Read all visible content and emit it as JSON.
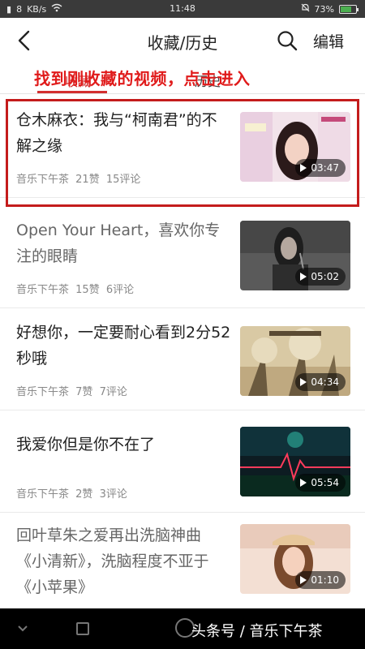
{
  "status_bar": {
    "signal": "8",
    "speed": "KB/s",
    "time": "11:48",
    "battery": "73%",
    "battery_level": 0.73
  },
  "app_bar": {
    "title": "收藏/历史",
    "edit_label": "编辑",
    "back_icon": "back-arrow-icon",
    "search_icon": "search-icon"
  },
  "tabs": [
    {
      "label": "收藏",
      "active": true
    },
    {
      "label": "历史",
      "active": false
    }
  ],
  "overlay_caption": "找到刚收藏的视频，点击进入",
  "videos": [
    {
      "title": "仓木麻衣：我与“柯南君”的不解之缘",
      "source": "音乐下午茶",
      "likes": "21赞",
      "comments": "15评论",
      "duration": "03:47"
    },
    {
      "title": "Open Your Heart，喜欢你专注的眼睛",
      "source": "音乐下午茶",
      "likes": "15赞",
      "comments": "6评论",
      "duration": "05:02"
    },
    {
      "title": "好想你，一定要耐心看到2分52秒哦",
      "source": "音乐下午茶",
      "likes": "7赞",
      "comments": "7评论",
      "duration": "04:34"
    },
    {
      "title": "我爱你但是你不在了",
      "source": "音乐下午茶",
      "likes": "2赞",
      "comments": "3评论",
      "duration": "05:54"
    },
    {
      "title": "回叶草朱之爱再出洗脑神曲《小清新》，洗脑程度不亚于《小苹果》",
      "source": "",
      "likes": "",
      "comments": "",
      "duration": "01:10"
    }
  ],
  "watermark": "头条号 / 音乐下午茶",
  "colors": {
    "accent": "#d32f2f",
    "highlight_box": "#c41c1c"
  }
}
